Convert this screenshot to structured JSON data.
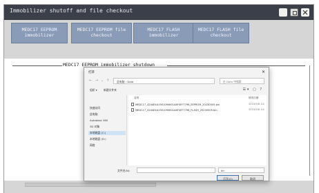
{
  "window": {
    "title": "Immobilizer shutoff and file checkout",
    "controls": [
      "minimize-icon",
      "maximize-icon",
      "close-icon"
    ]
  },
  "tabs": [
    {
      "line1": "MEDC17 EEPROM",
      "line2": "immobilizer"
    },
    {
      "line1": "MEDC17 EEPROM file",
      "line2": "checkout"
    },
    {
      "line1": "MEDC17 FLASH",
      "line2": "immobilizer"
    },
    {
      "line1": "MEDC17 FLASH file",
      "line2": "checkout"
    }
  ],
  "section": {
    "title": "MEDC17 EEPROM immobilizer shutdown"
  },
  "dialog": {
    "title": "打开",
    "address": "此电脑 › Data",
    "search_placeholder": "在 Data 中搜索",
    "organize": "组织 ▾",
    "new_folder": "新建文件夹",
    "columns": {
      "name": "名称",
      "date": "修改日期"
    },
    "nav": [
      "快速访问",
      "此电脑",
      "Autodesk 360",
      "3D 对象",
      "本地磁盘 (C:)",
      "本地磁盘 (D:)",
      "网络"
    ],
    "files": [
      {
        "name": "MEDC17_4244E4A1901090601A8F4FF7796_EEPROM_20230505.bin",
        "date": "2023/5/8 14:"
      },
      {
        "name": "MEDC17_4244E4A1901090601A8F4FF7796_FLASH_20230505.bin",
        "date": "2023/5/8 14:"
      }
    ],
    "filename_label": "文件名(N):",
    "filetype": "bin",
    "open_button": "打开(O)",
    "cancel_button": "取消"
  },
  "colors": {
    "titlebar": "#3a3f4a",
    "tab_bg": "#8a9bb8",
    "app_bg": "#d6d6d6"
  }
}
